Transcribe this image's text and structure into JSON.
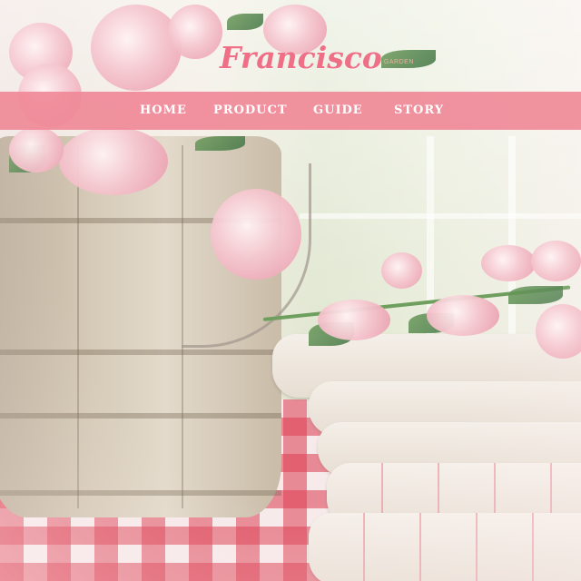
{
  "brand": {
    "name": "Francisco",
    "tagline": "GARDEN",
    "color": "#ee6f86"
  },
  "nav": {
    "background": "#f08998",
    "items": [
      {
        "label": "HOME"
      },
      {
        "label": "PRODUCT"
      },
      {
        "label": "GUIDE"
      },
      {
        "label": "STORY"
      }
    ]
  },
  "hero": {
    "image": "still-life photo: rustic wooden bucket with pink tulips, folded linen towels on a pink gingham tablecloth"
  }
}
